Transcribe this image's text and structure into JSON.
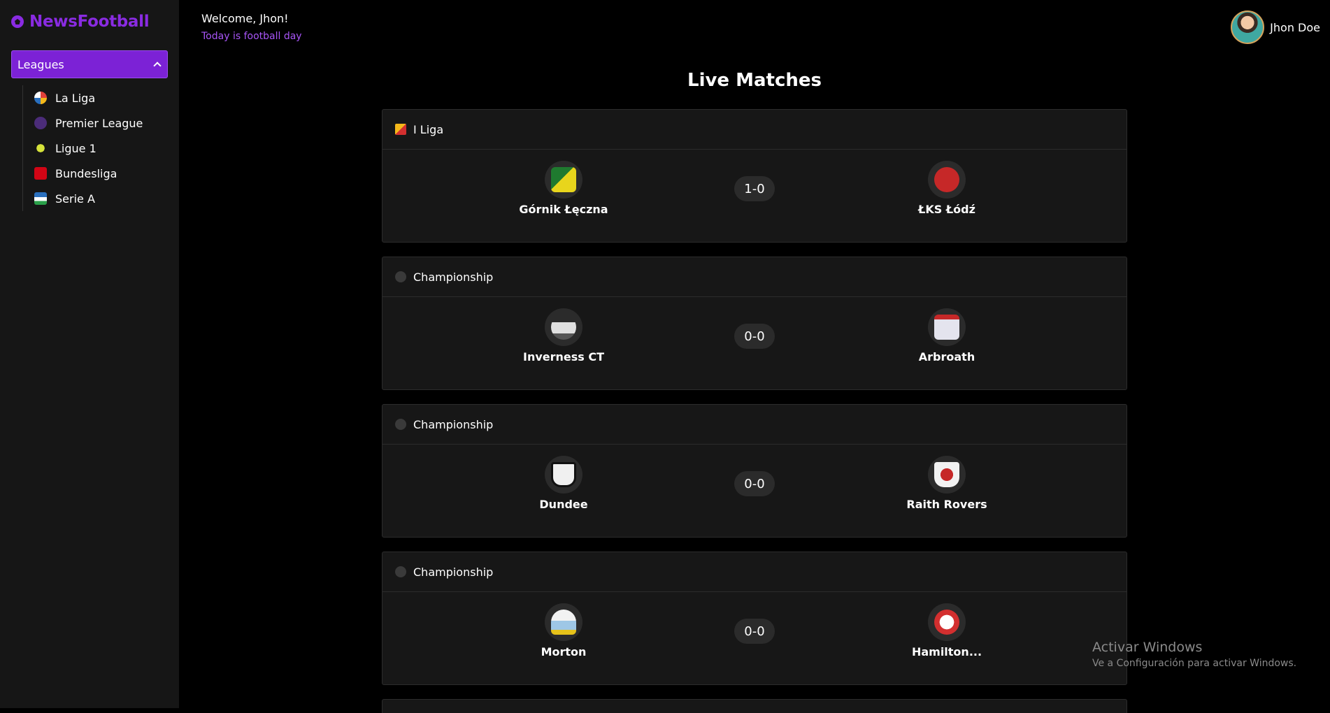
{
  "brand": {
    "name": "NewsFootball",
    "accent": "#8a2be2"
  },
  "sidebar": {
    "dropdown_label": "Leagues",
    "leagues": [
      {
        "label": "La Liga",
        "logo_color": "#e0413a",
        "icon": "la-liga-logo"
      },
      {
        "label": "Premier League",
        "logo_color": "#4b2c79",
        "icon": "premier-league-logo"
      },
      {
        "label": "Ligue 1",
        "logo_color": "#d6e33a",
        "icon": "ligue-1-logo"
      },
      {
        "label": "Bundesliga",
        "logo_color": "#d20515",
        "icon": "bundesliga-logo"
      },
      {
        "label": "Serie A",
        "logo_color": "#2a6fbd",
        "icon": "serie-a-logo"
      }
    ]
  },
  "header": {
    "welcome": "Welcome, Jhon!",
    "subtitle": "Today is football day",
    "user_name": "Jhon Doe"
  },
  "main": {
    "title": "Live Matches",
    "matches": [
      {
        "competition": "I Liga",
        "competition_color": "#d32f2f",
        "home": {
          "name": "Górnik Łęczna",
          "crest_color": "#d4c21a"
        },
        "away": {
          "name": "ŁKS Łódź",
          "crest_color": "#c62828"
        },
        "score": "1-0"
      },
      {
        "competition": "Championship",
        "competition_color": "#3a3a3a",
        "home": {
          "name": "Inverness CT",
          "crest_color": "#555555"
        },
        "away": {
          "name": "Arbroath",
          "crest_color": "#b0b0c8"
        },
        "score": "0-0"
      },
      {
        "competition": "Championship",
        "competition_color": "#3a3a3a",
        "home": {
          "name": "Dundee",
          "crest_color": "#eeeeee"
        },
        "away": {
          "name": "Raith Rovers",
          "crest_color": "#c62828"
        },
        "score": "0-0"
      },
      {
        "competition": "Championship",
        "competition_color": "#3a3a3a",
        "home": {
          "name": "Morton",
          "crest_color": "#9ec7e6"
        },
        "away": {
          "name": "Hamilton...",
          "crest_color": "#d32f2f"
        },
        "score": "0-0"
      }
    ]
  },
  "watermark": {
    "title": "Activar Windows",
    "subtitle": "Ve a Configuración para activar Windows."
  }
}
